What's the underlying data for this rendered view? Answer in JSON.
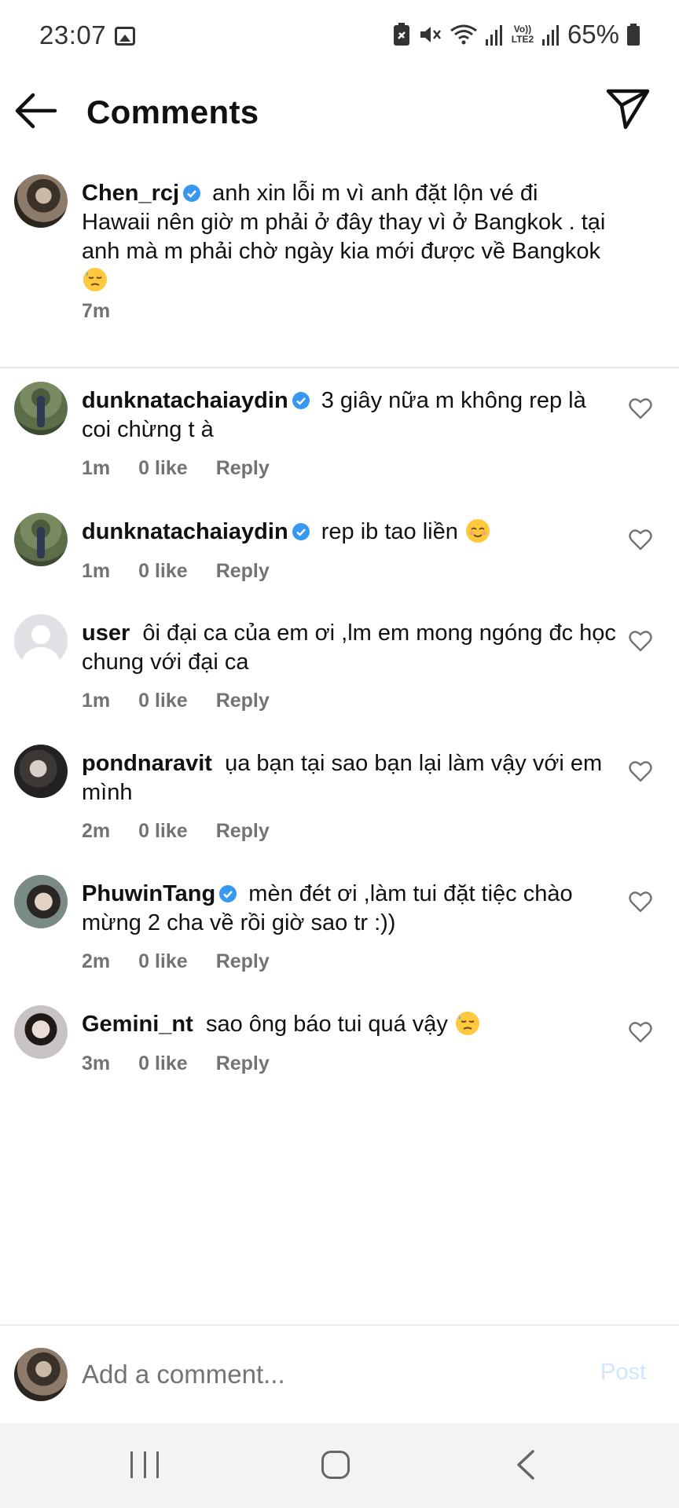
{
  "status_bar": {
    "time": "23:07",
    "network_label": "Vo)) LTE2",
    "battery": "65%",
    "icons": [
      "gallery-icon",
      "battery-saver-icon",
      "mute-icon",
      "wifi-icon",
      "signal-icon",
      "battery-icon"
    ]
  },
  "header": {
    "title": "Comments",
    "back_icon": "arrow-left-icon",
    "share_icon": "paper-plane-icon"
  },
  "caption": {
    "username": "Chen_rcj",
    "verified": true,
    "text": "anh xin lỗi m vì anh đặt lộn vé đi Hawaii nên giờ m phải ở đây thay vì ở Bangkok . tại anh mà m phải chờ ngày kia mới được về Bangkok",
    "emoji": "downcast-sweat-emoji",
    "time": "7m"
  },
  "comments": [
    {
      "username": "dunknatachaiaydin",
      "verified": true,
      "text": "3 giây nữa m không rep là coi chừng t à",
      "time": "1m",
      "likes": "0 like",
      "reply": "Reply"
    },
    {
      "username": "dunknatachaiaydin",
      "verified": true,
      "text": "rep ib tao liền",
      "time": "1m",
      "likes": "0 like",
      "reply": "Reply"
    },
    {
      "username": "user",
      "verified": false,
      "text": "ôi đại ca của em ơi ,lm em mong ngóng đc học chung với đại ca",
      "time": "1m",
      "likes": "0 like",
      "reply": "Reply"
    },
    {
      "username": "pondnaravit",
      "verified": false,
      "text": "ụa bạn tại sao bạn lại làm vậy với em mình",
      "time": "2m",
      "likes": "0 like",
      "reply": "Reply"
    },
    {
      "username": "PhuwinTang",
      "verified": true,
      "text": "mèn đét ơi ,làm tui đặt tiệc chào mừng 2 cha về rồi giờ sao tr :))",
      "time": "2m",
      "likes": "0 like",
      "reply": "Reply"
    },
    {
      "username": "Gemini_nt",
      "verified": false,
      "text": "sao ông báo tui quá vậy",
      "time": "3m",
      "likes": "0 like",
      "reply": "Reply"
    }
  ],
  "composer": {
    "placeholder": "Add a comment...",
    "post_label": "Post"
  },
  "colors": {
    "verified_blue": "#3897f0",
    "meta_gray": "#737373",
    "post_disabled": "#cfe6fb"
  }
}
